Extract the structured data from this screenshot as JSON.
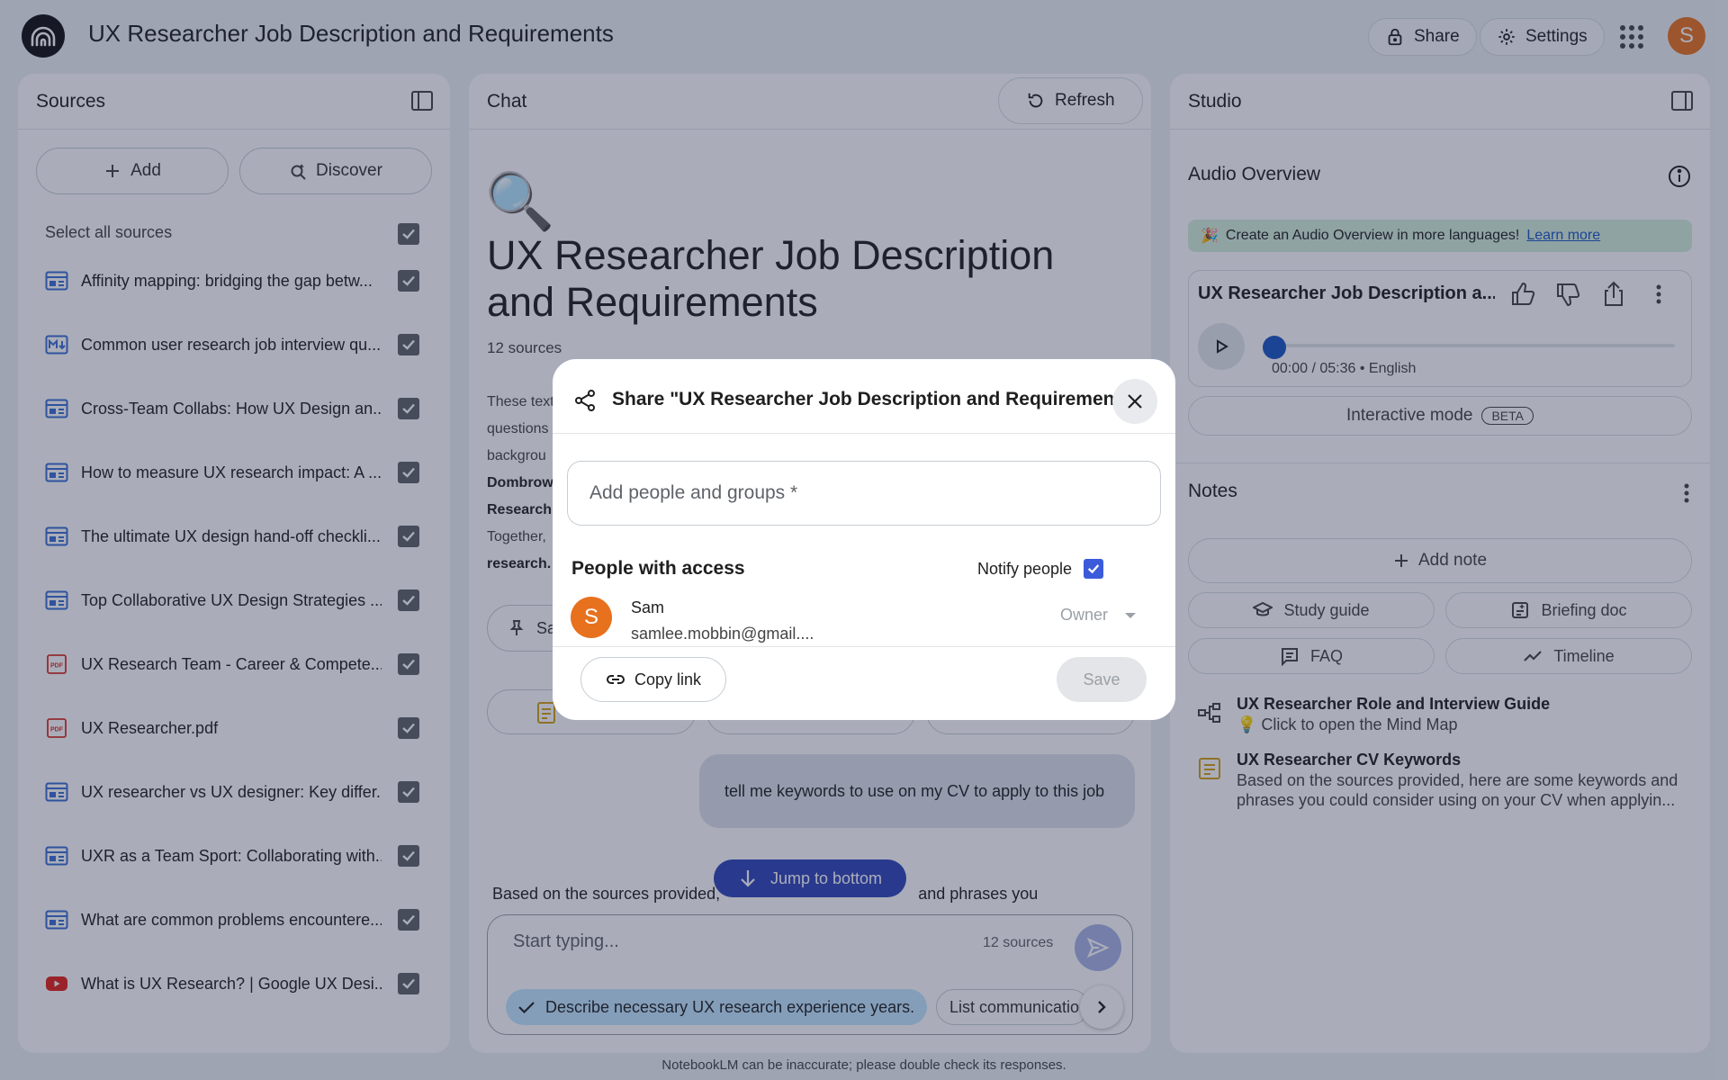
{
  "header": {
    "title": "UX Researcher Job Description and Requirements",
    "share_label": "Share",
    "settings_label": "Settings",
    "avatar_letter": "S"
  },
  "sources": {
    "title": "Sources",
    "add_label": "Add",
    "discover_label": "Discover",
    "select_all_label": "Select all sources",
    "items": [
      {
        "label": "Affinity mapping: bridging the gap betw...",
        "icon": "web-doc-icon"
      },
      {
        "label": "Common user research job interview qu...",
        "icon": "markdown-icon"
      },
      {
        "label": "Cross-Team Collabs: How UX Design an...",
        "icon": "web-doc-icon"
      },
      {
        "label": "How to measure UX research impact: A ...",
        "icon": "web-doc-icon"
      },
      {
        "label": "The ultimate UX design hand-off checkli...",
        "icon": "web-doc-icon"
      },
      {
        "label": "Top Collaborative UX Design Strategies ...",
        "icon": "web-doc-icon"
      },
      {
        "label": "UX Research Team - Career & Compete...",
        "icon": "pdf-icon"
      },
      {
        "label": "UX Researcher.pdf",
        "icon": "pdf-icon"
      },
      {
        "label": "UX researcher vs UX designer: Key differ...",
        "icon": "web-doc-icon"
      },
      {
        "label": "UXR as a Team Sport: Collaborating with...",
        "icon": "web-doc-icon"
      },
      {
        "label": "What are common problems encountere...",
        "icon": "web-doc-icon"
      },
      {
        "label": "What is UX Research? | Google UX Desi...",
        "icon": "youtube-icon"
      }
    ]
  },
  "chat": {
    "title": "Chat",
    "refresh_label": "Refresh",
    "notebook_title": "UX Researcher Job Description and Requirements",
    "sources_count": "12 sources",
    "summary_lines": [
      "These text",
      "questions",
      "backgrou",
      "Dombrow",
      "Research",
      "Together,",
      "research."
    ],
    "save_note_label": "Sa",
    "user_message": "tell me keywords to use on my CV to apply to this job",
    "response_text": "Based on the sources provided, here are some keywords and phrases you",
    "response_hidden_left": "Based on the sources provided,",
    "response_hidden_right": "and phrases you",
    "jump_label": "Jump to bottom",
    "input_placeholder": "Start typing...",
    "input_sources": "12 sources",
    "suggestions": [
      "Describe necessary UX research experience years.",
      "List communicatio"
    ]
  },
  "studio": {
    "title": "Studio",
    "audio_overview_title": "Audio Overview",
    "banner_text": "Create an Audio Overview in more languages!",
    "banner_link": "Learn more",
    "audio_card_title": "UX Researcher Job Description a...",
    "audio_time": "00:00 / 05:36 • English",
    "audio_progress": 0,
    "interactive_label": "Interactive mode",
    "beta_label": "BETA",
    "notes_title": "Notes",
    "add_note_label": "Add note",
    "buttons": [
      "Study guide",
      "Briefing doc",
      "FAQ",
      "Timeline"
    ],
    "notes": [
      {
        "title": "UX Researcher Role and Interview Guide",
        "body": "💡 Click to open the Mind Map"
      },
      {
        "title": "UX Researcher CV Keywords",
        "body": "Based on the sources provided, here are some keywords and phrases you could consider using on your CV when applyin..."
      }
    ]
  },
  "footer": "NotebookLM can be inaccurate; please double check its responses.",
  "dialog": {
    "title": "Share \"UX Researcher Job Description and Requirements\"",
    "input_placeholder": "Add people and groups *",
    "people_heading": "People with access",
    "notify_label": "Notify people",
    "notify_checked": true,
    "person": {
      "avatar_letter": "S",
      "name": "Sam",
      "email": "samlee.mobbin@gmail....",
      "role": "Owner"
    },
    "copy_link_label": "Copy link",
    "save_label": "Save"
  },
  "colors": {
    "accent": "#3b5bdb",
    "avatar": "#e8711e",
    "jump_button": "#2f45b8",
    "suggestion_chip": "#c2e7ff",
    "banner": "#d6efdc"
  }
}
